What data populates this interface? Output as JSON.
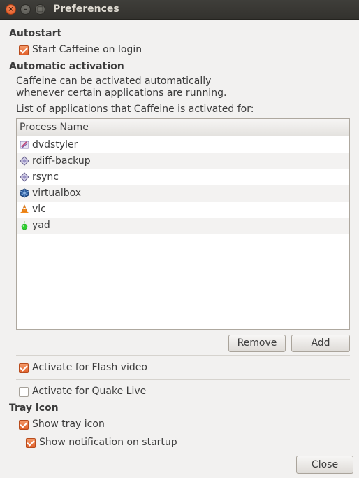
{
  "window": {
    "title": "Preferences"
  },
  "autostart": {
    "heading": "Autostart",
    "start_on_login": {
      "label": "Start Caffeine on login",
      "checked": true
    }
  },
  "activation": {
    "heading": "Automatic activation",
    "desc_line1": "Caffeine can be activated automatically",
    "desc_line2": "whenever certain applications are running.",
    "list_caption": "List of applications that Caffeine is activated for:",
    "column_header": "Process Name",
    "processes": [
      {
        "name": "dvdstyler",
        "icon": "dvdstyler-icon"
      },
      {
        "name": "rdiff-backup",
        "icon": "rdiff-backup-icon"
      },
      {
        "name": "rsync",
        "icon": "rsync-icon"
      },
      {
        "name": "virtualbox",
        "icon": "virtualbox-icon"
      },
      {
        "name": "vlc",
        "icon": "vlc-icon"
      },
      {
        "name": "yad",
        "icon": "yad-icon"
      }
    ],
    "remove_label": "Remove",
    "add_label": "Add",
    "flash": {
      "label": "Activate for Flash video",
      "checked": true
    },
    "quake": {
      "label": "Activate for Quake Live",
      "checked": false
    }
  },
  "tray": {
    "heading": "Tray icon",
    "show_tray": {
      "label": "Show tray icon",
      "checked": true
    },
    "show_notification": {
      "label": "Show notification on startup",
      "checked": true
    }
  },
  "close_label": "Close",
  "colors": {
    "accent": "#e1602a",
    "titlebar": "#3c3b37"
  }
}
